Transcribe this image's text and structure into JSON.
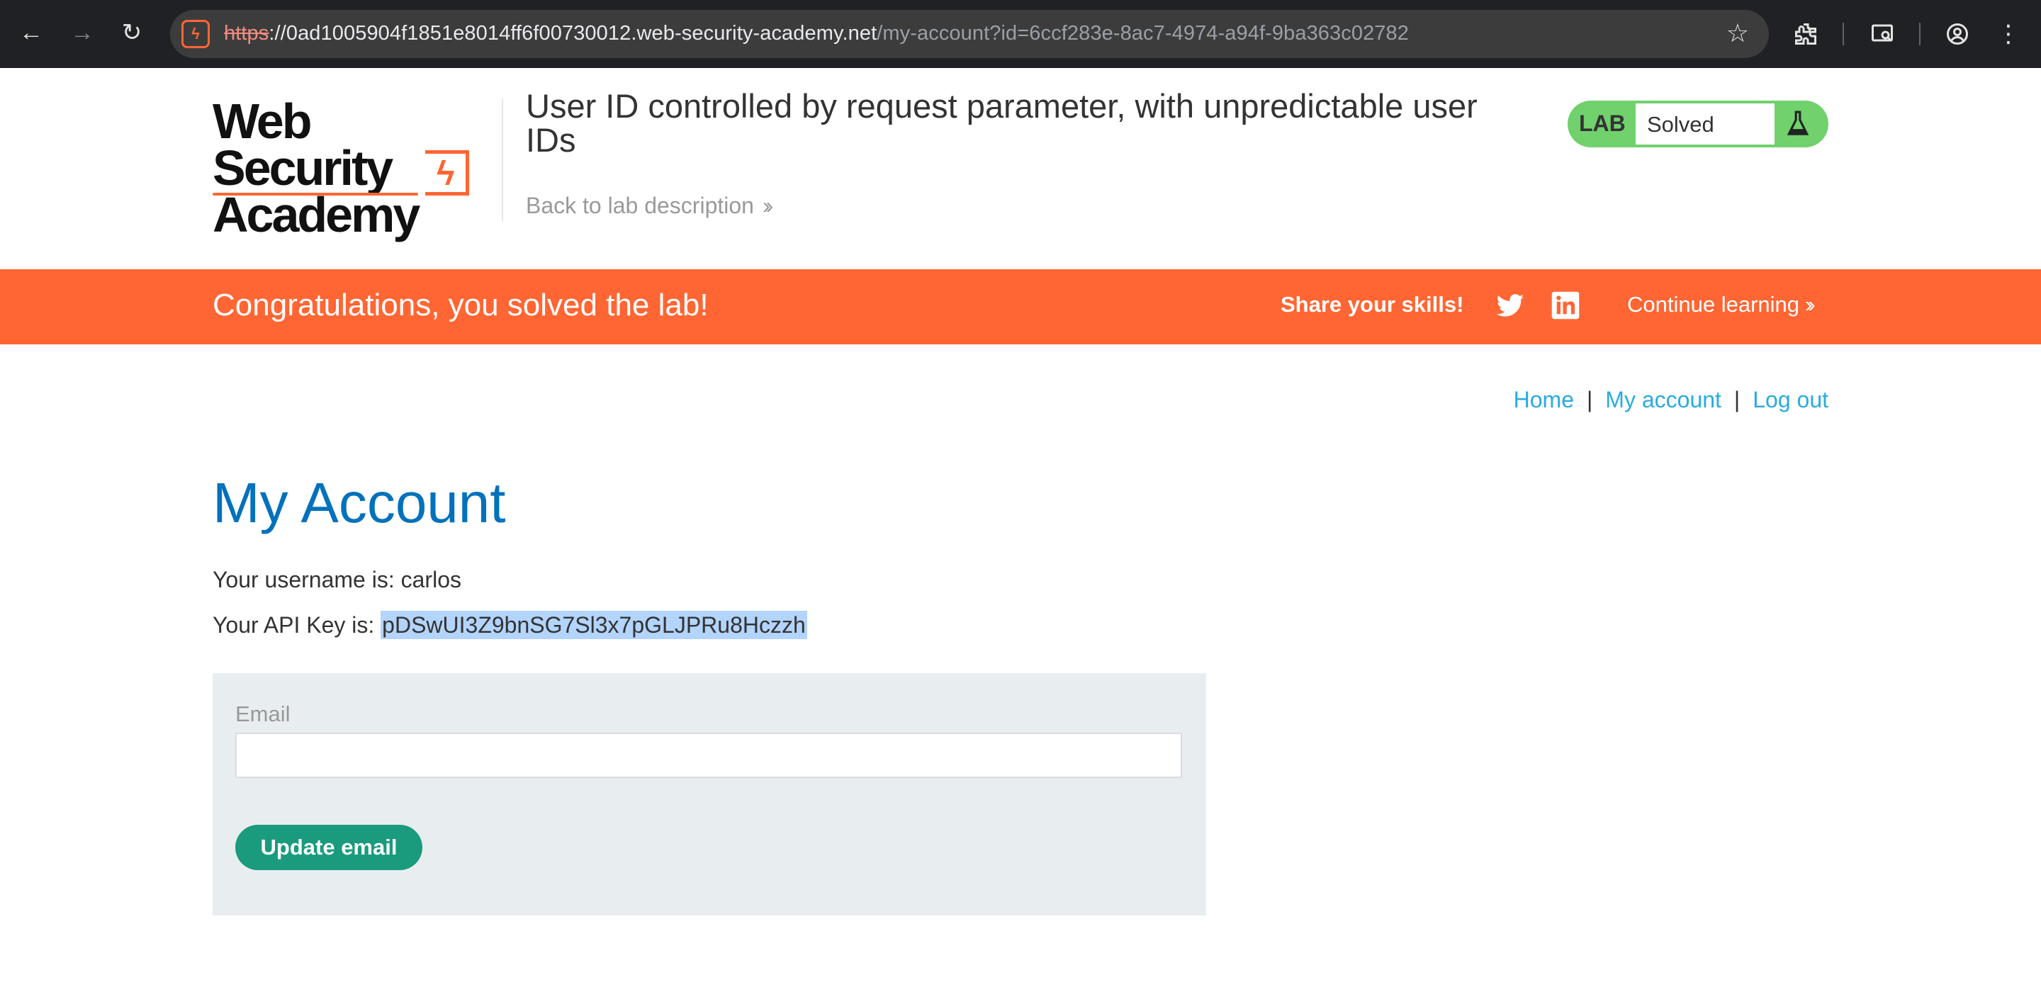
{
  "browser": {
    "url_scheme": "https",
    "url_domain": "://0ad1005904f1851e8014ff6f00730012.web-security-academy.net",
    "url_path": "/my-account?id=6ccf283e-8ac7-4974-a94f-9ba363c02782"
  },
  "header": {
    "logo_line1": "Web Security",
    "logo_line2": "Academy",
    "lab_title": "User ID controlled by request parameter, with unpredictable user IDs",
    "back_link": "Back to lab description",
    "lab_badge": "LAB",
    "lab_state": "Solved"
  },
  "banner": {
    "message": "Congratulations, you solved the lab!",
    "share": "Share your skills!",
    "continue": "Continue learning"
  },
  "nav": {
    "home": "Home",
    "my_account": "My account",
    "log_out": "Log out"
  },
  "main": {
    "title": "My Account",
    "username_prefix": "Your username is: ",
    "username": "carlos",
    "api_prefix": "Your API Key is: ",
    "api_key": "pDSwUI3Z9bnSG7Sl3x7pGLJPRu8Hczzh",
    "email_label": "Email",
    "email_value": "",
    "update_button": "Update email"
  },
  "colors": {
    "accent": "#ff6633",
    "link": "#29abe0",
    "title": "#0071bc",
    "button": "#1a9b7d",
    "lab_green": "#70d16d"
  }
}
